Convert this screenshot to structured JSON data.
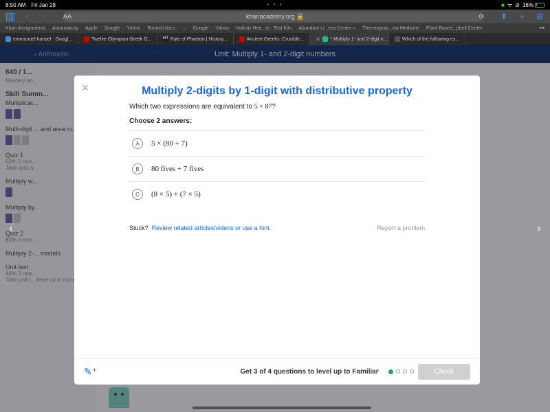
{
  "status": {
    "time": "8:50 AM",
    "date": "Fri Jan 28",
    "battery_pct": "16%"
  },
  "browser": {
    "address": "khanacademy.org",
    "aa_label": "AA"
  },
  "bookmarks": [
    "Khan Assignments",
    "Automaticity",
    "Apple",
    "Google",
    "Yahoo",
    "Biomed docs",
    "Google",
    "Yahoo",
    "Holistic Hea...ts - Test Kits",
    "Abundant Li...ess Center »",
    "Thermograp...ew Medicine",
    "Plant-Based...pbell Center"
  ],
  "tabs": [
    {
      "label": "emmanuel hansel - Googl...",
      "icon_color": "#4285f4"
    },
    {
      "label": "Twelve Olympian Greek G...",
      "icon_color": "#cc0000"
    },
    {
      "label": "Fate of Phaeton | History...",
      "icon_color": "#8b4513"
    },
    {
      "label": "Ancient Greeks: Crucible...",
      "icon_color": "#cc0000"
    },
    {
      "label": "* Multiply 1- and 2-digit n...",
      "icon_color": "#14bf96",
      "active": true
    },
    {
      "label": "Which of the following ex...",
      "icon_color": "#555"
    }
  ],
  "ka_header": {
    "back": "‹ Arithmetic",
    "unit": "Unit: Multiply 1- and 2-digit numbers"
  },
  "sidebar": {
    "progress_title": "640 / 1...",
    "progress_sub": "Mastery po...",
    "summary": "Skill Summ...",
    "items": [
      {
        "title": "Multiplicat...",
        "blocks": [
          "p",
          "p"
        ]
      },
      {
        "title": "Multi-digit ... and area m...",
        "blocks": [
          "p",
          "g",
          "g"
        ]
      },
      {
        "title": "Quiz 1",
        "sub": "60% 2 mor...",
        "extra": "Take quiz a..."
      },
      {
        "title": "Multiply w...",
        "blocks": [
          "p"
        ]
      },
      {
        "title": "Multiply by...",
        "blocks": [
          "p",
          "g"
        ]
      },
      {
        "title": "Quiz 2",
        "sub": "80% 3 mor..."
      },
      {
        "title": "Multiply 2-... models",
        "sub": ""
      },
      {
        "title": "Unit test",
        "sub": "44% 3 mor...",
        "extra": "Take unit t... level up in more skills"
      }
    ]
  },
  "modal": {
    "title": "Multiply 2-digits by 1-digit with distributive property",
    "prompt_pre": "Which two expressions are equivalent to ",
    "prompt_math": "5 × 87",
    "prompt_post": "?",
    "instruction": "Choose 2 answers:",
    "answers": [
      {
        "letter": "A",
        "text": "5 × (80 + 7)"
      },
      {
        "letter": "B",
        "text": "80 fives + 7 fives"
      },
      {
        "letter": "C",
        "text": "(8 × 5) + (7 × 5)"
      }
    ],
    "stuck_label": "Stuck?",
    "stuck_link": "Review related articles/videos or use a hint.",
    "report": "Report a problem",
    "footer_text": "Get 3 of 4 questions to level up to Familiar",
    "check_label": "Check"
  }
}
